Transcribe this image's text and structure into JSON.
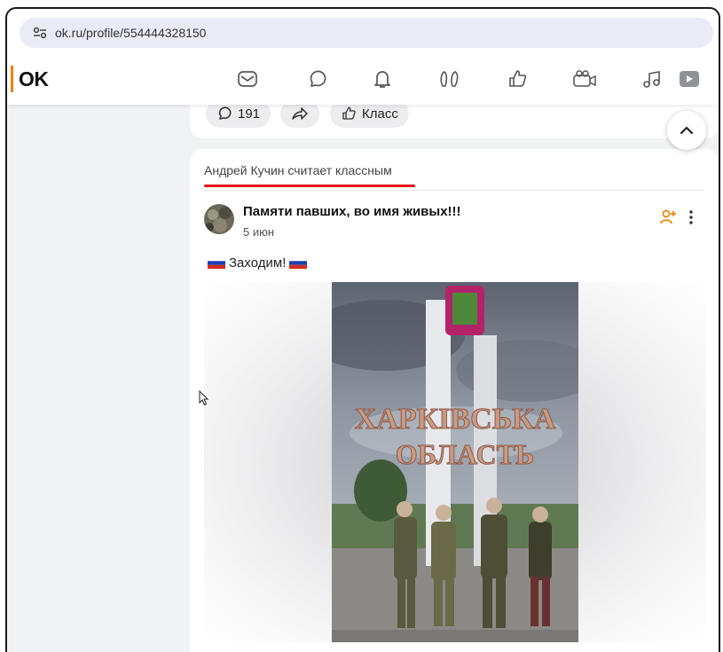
{
  "browser": {
    "url": "ok.ru/profile/554444328150"
  },
  "nav": {
    "logo": "OK",
    "icons": [
      "mail-icon",
      "chat-icon",
      "bell-icon",
      "guests-icon",
      "like-icon",
      "video-chat-icon",
      "music-icon",
      "video-icon"
    ]
  },
  "previous_post": {
    "comments_count": "191",
    "class_label": "Класс"
  },
  "post": {
    "liked_by": "Андрей Кучин считает классным",
    "group_name": "Памяти павших, во имя живых!!!",
    "date": "5 июн",
    "text": "Заходим!",
    "sign_line1": "ХАРКІВСЬКА",
    "sign_line2": "ОБЛАСТЬ"
  },
  "colors": {
    "accent_orange": "#ee8208",
    "underline_red": "#e5151b",
    "url_bar": "#e9ebf7",
    "feed_bg": "#f1f2f4"
  }
}
